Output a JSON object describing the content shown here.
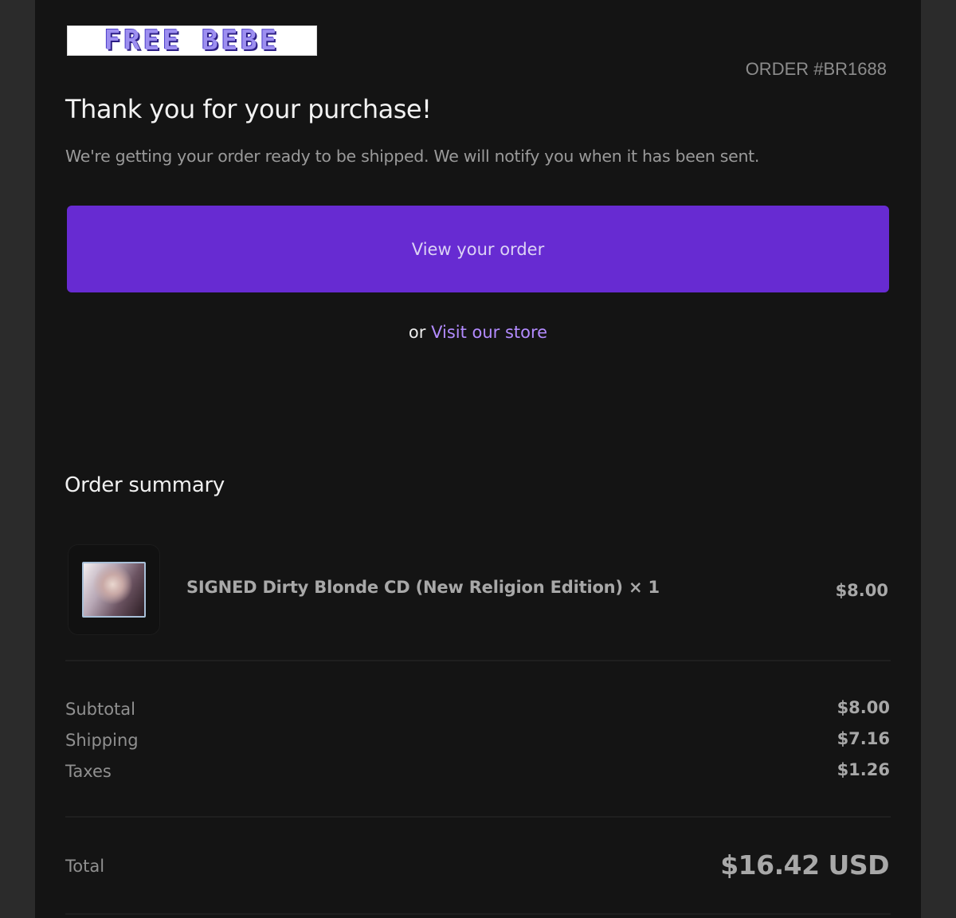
{
  "brand": {
    "logo_text": "FREE BEBE"
  },
  "order": {
    "number": "ORDER #BR1688"
  },
  "header": {
    "title": "Thank you for your purchase!",
    "subtitle": "We're getting your order ready to be shipped. We will notify you when it has been sent."
  },
  "actions": {
    "view_order_label": "View your order",
    "or_text": "or",
    "visit_store_label": "Visit our store"
  },
  "summary": {
    "title": "Order summary",
    "items": [
      {
        "name": "SIGNED Dirty Blonde CD (New Religion Edition) × 1",
        "price": "$8.00",
        "thumbnail_icon": "cd-cover-image"
      }
    ],
    "subtotal_label": "Subtotal",
    "subtotal_value": "$8.00",
    "shipping_label": "Shipping",
    "shipping_value": "$7.16",
    "taxes_label": "Taxes",
    "taxes_value": "$1.26",
    "total_label": "Total",
    "total_value": "$16.42 USD"
  },
  "colors": {
    "page_bg": "#2b2b2b",
    "card_bg": "#141414",
    "accent": "#672bd2",
    "link": "#b38bff"
  }
}
